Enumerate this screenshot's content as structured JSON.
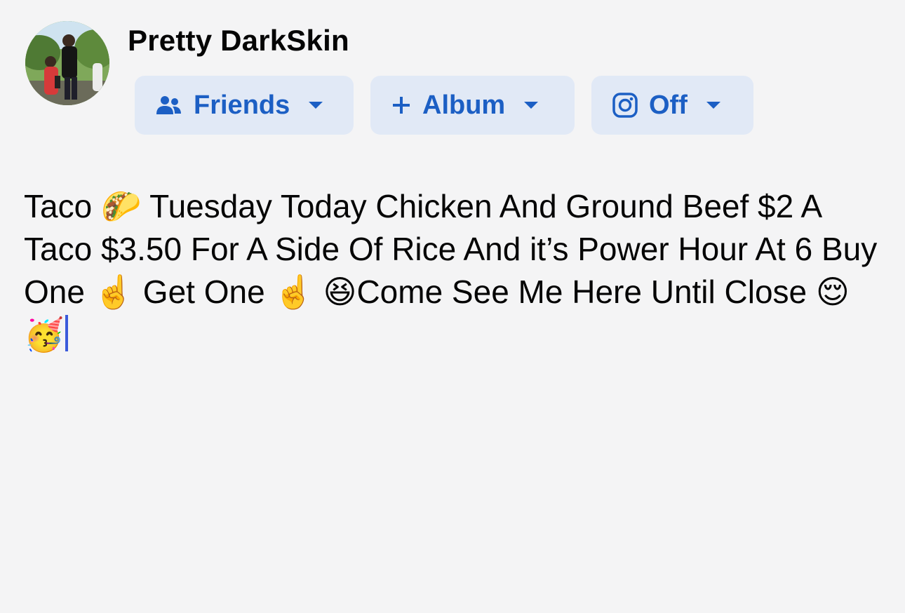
{
  "author": {
    "name": "Pretty DarkSkin"
  },
  "audience_chips": [
    {
      "label": "Friends",
      "icon": "friends-icon"
    },
    {
      "label": "Album",
      "icon": "plus-icon"
    },
    {
      "label": "Off",
      "icon": "instagram-icon"
    }
  ],
  "post": {
    "text": "Taco 🌮 Tuesday Today Chicken And Ground Beef $2 A Taco $3.50 For A Side Of Rice And it’s Power Hour At 6 Buy One ☝️ Get One ☝️ 😆Come See Me Here Until Close 😌🥳"
  },
  "colors": {
    "background": "#f4f4f5",
    "chip_background": "#e1e9f6",
    "accent": "#1c5fc4",
    "text_cursor": "#3b5bdb"
  }
}
